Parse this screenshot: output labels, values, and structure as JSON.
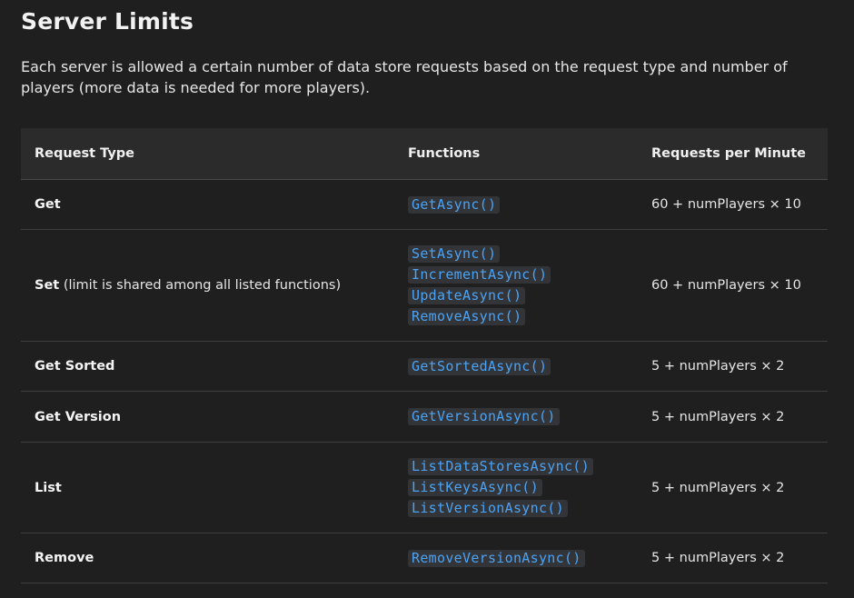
{
  "page": {
    "title": "Server Limits",
    "intro": "Each server is allowed a certain number of data store requests based on the request type and number of players (more data is needed for more players)."
  },
  "table": {
    "headers": [
      "Request Type",
      "Functions",
      "Requests per Minute"
    ],
    "rows": [
      {
        "type": "Get",
        "note": "",
        "functions": [
          "GetAsync()"
        ],
        "limit": "60 + numPlayers × 10"
      },
      {
        "type": "Set",
        "note": " (limit is shared among all listed functions)",
        "functions": [
          "SetAsync()",
          "IncrementAsync()",
          "UpdateAsync()",
          "RemoveAsync()"
        ],
        "limit": "60 + numPlayers × 10"
      },
      {
        "type": "Get Sorted",
        "note": "",
        "functions": [
          "GetSortedAsync()"
        ],
        "limit": "5 + numPlayers × 2"
      },
      {
        "type": "Get Version",
        "note": "",
        "functions": [
          "GetVersionAsync()"
        ],
        "limit": "5 + numPlayers × 2"
      },
      {
        "type": "List",
        "note": "",
        "functions": [
          "ListDataStoresAsync()",
          "ListKeysAsync()",
          "ListVersionAsync()"
        ],
        "limit": "5 + numPlayers × 2"
      },
      {
        "type": "Remove",
        "note": "",
        "functions": [
          "RemoveVersionAsync()"
        ],
        "limit": "5 + numPlayers × 2"
      }
    ]
  },
  "colors": {
    "background": "#1f1f1f",
    "header_background": "#2b2b2b",
    "code_text": "#4aa3f5",
    "code_background": "#333438"
  }
}
